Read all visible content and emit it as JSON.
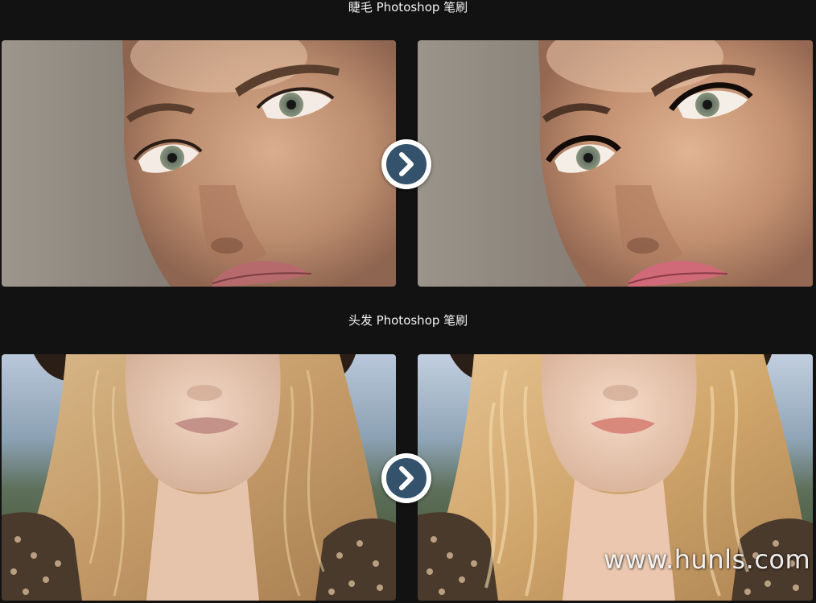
{
  "sections": [
    {
      "title": "睫毛 Photoshop 笔刷",
      "before_image": "eyelashes-before-photo",
      "after_image": "eyelashes-after-photo",
      "arrow_icon": "chevron-right-icon"
    },
    {
      "title": "头发 Photoshop 笔刷",
      "before_image": "hair-before-photo",
      "after_image": "hair-after-photo",
      "arrow_icon": "chevron-right-icon"
    }
  ],
  "watermark": "www.hunls.com",
  "colors": {
    "background": "#121212",
    "title_text": "#f2f2f2",
    "arrow_circle": "#34526c",
    "arrow_ring": "#ffffff"
  }
}
